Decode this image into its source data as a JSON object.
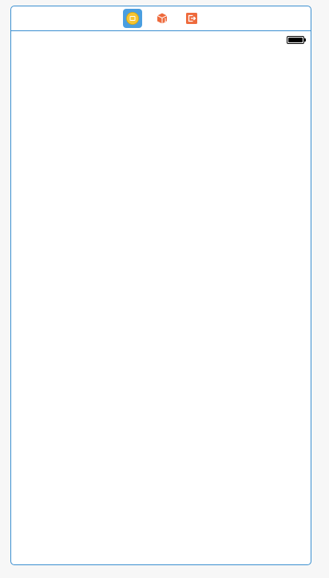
{
  "scene": {
    "dock": {
      "items": [
        {
          "icon": "view-controller-icon",
          "selected": true
        },
        {
          "icon": "first-responder-icon",
          "selected": false
        },
        {
          "icon": "exit-icon",
          "selected": false
        }
      ]
    },
    "status_bar": {
      "battery": {
        "icon": "battery-icon",
        "level": 1.0
      }
    }
  },
  "colors": {
    "accent": "#3b8fd0",
    "selected_bg": "#4a9ee0",
    "view_controller_icon": "#f5c433",
    "first_responder_icon": "#ee6a3c",
    "exit_icon": "#ee6a3c"
  }
}
